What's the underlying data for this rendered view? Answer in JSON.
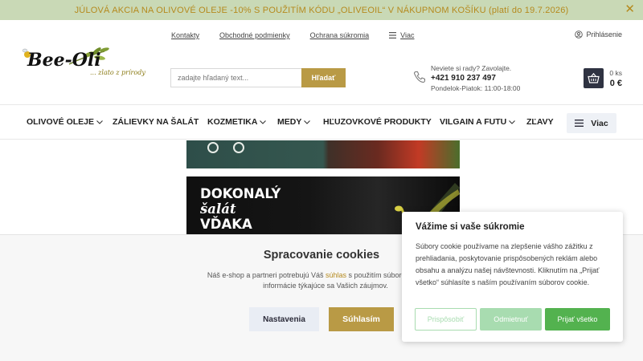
{
  "promo": {
    "text": "JÚLOVÁ AKCIA NA OLIVOVÉ OLEJE -10% S POUŽITÍM KÓDU „OLIVEOIL“ V NÁKUPNOM KOŠÍKU (platí do 19.7.2026)"
  },
  "logo": {
    "name": "Bee-Oli",
    "tagline": "... zlato z prírody"
  },
  "top_links": [
    "Kontakty",
    "Obchodné podmienky",
    "Ochrana súkromia",
    "Viac"
  ],
  "login_label": "Prihlásenie",
  "search": {
    "placeholder": "zadajte hľadaný text...",
    "button": "Hľadať"
  },
  "contact": {
    "prompt": "Neviete si rady? Zavolajte.",
    "phone": "+421 910 237 497",
    "hours": "Pondelok-Piatok: 11:00-18:00"
  },
  "cart": {
    "items": "0 ks",
    "total": "0 €"
  },
  "nav": {
    "items": [
      "OLIVOVÉ OLEJE",
      "ZÁLIEVKY NA ŠALÁT",
      "KOZMETIKA",
      "MEDY",
      "HĽUZOVKOVÉ PRODUKTY",
      "VILGAIN A FUTU",
      "ZĽAVY"
    ],
    "more": "Viac"
  },
  "banner": {
    "line1": "DOKONALÝ",
    "line2": "šalát",
    "line3": "VĎAKA"
  },
  "cookie_bar": {
    "title": "Spracovanie cookies",
    "text_before": "Náš e-shop a partneri potrebujú Váš ",
    "link": "súhlas",
    "text_after": " s použitím súborov cookies, a",
    "text_line2": "informácie týkajúce sa Vašich záujmov.",
    "settings": "Nastavenia",
    "accept": "Súhlasím"
  },
  "privacy": {
    "title": "Vážime si vaše súkromie",
    "text": "Súbory cookie používame na zlepšenie vášho zážitku z prehliadania, poskytovanie prispôsobených reklám alebo obsahu a analýzu našej návštevnosti. Kliknutím na „Prijať všetko“ súhlasíte s naším používaním súborov cookie.",
    "customize": "Prispôsobiť",
    "reject": "Odmietnuť",
    "accept_all": "Prijať všetko"
  },
  "colors": {
    "gold": "#b99a45",
    "promo_bg": "#c9d9b6",
    "green": "#53b24f",
    "dark": "#2f3342"
  },
  "icons": [
    "close-icon",
    "menu-icon",
    "user-icon",
    "phone-icon",
    "basket-icon",
    "chevron-down-icon",
    "olive-branch-icon"
  ]
}
